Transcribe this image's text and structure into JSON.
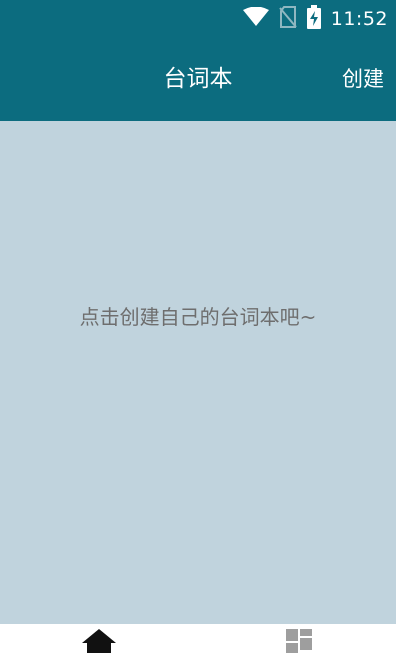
{
  "status_bar": {
    "time": "11:52",
    "icons": [
      "wifi-icon",
      "no-sim-icon",
      "battery-charging-icon"
    ]
  },
  "app_bar": {
    "title": "台词本",
    "create_label": "创建"
  },
  "main": {
    "empty_message": "点击创建自己的台词本吧~"
  },
  "bottom_nav": {
    "items": [
      {
        "icon": "home-icon"
      },
      {
        "icon": "grid-icon"
      }
    ]
  },
  "colors": {
    "primary": "#0c6c7f",
    "background": "#c0d3dd",
    "message_text": "#6e6e6e"
  }
}
